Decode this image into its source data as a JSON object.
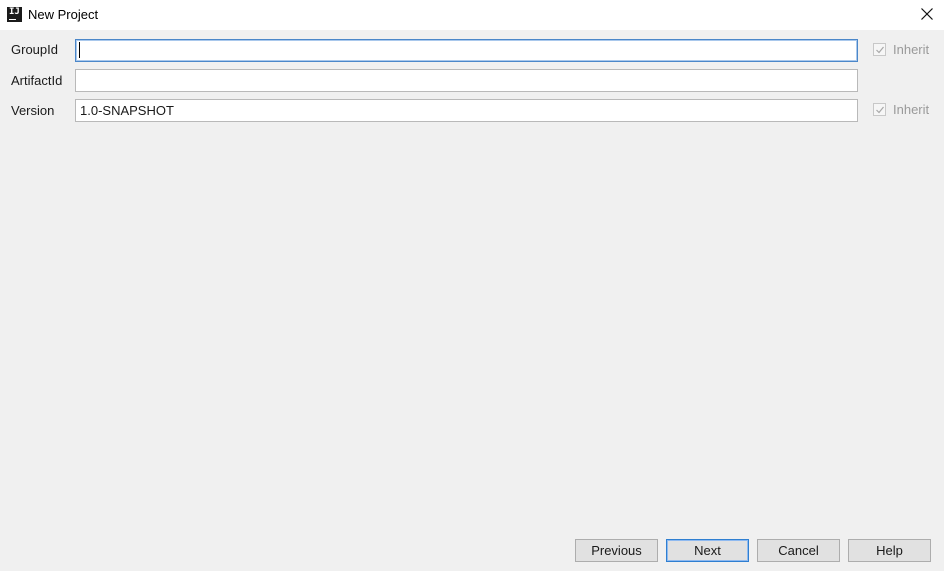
{
  "window": {
    "title": "New Project",
    "app_icon_text": "IJ"
  },
  "form": {
    "group_id": {
      "label": "GroupId",
      "value": "",
      "inherit_label": "Inherit",
      "inherit_checked": true
    },
    "artifact_id": {
      "label": "ArtifactId",
      "value": ""
    },
    "version": {
      "label": "Version",
      "value": "1.0-SNAPSHOT",
      "inherit_label": "Inherit",
      "inherit_checked": true
    }
  },
  "buttons": {
    "previous": "Previous",
    "next": "Next",
    "cancel": "Cancel",
    "help": "Help"
  },
  "colors": {
    "window_background": "#f0f0f0",
    "focus_border": "#4b87c9",
    "default_button_border": "#2f7fd1",
    "disabled_text": "#9a9a9a"
  }
}
